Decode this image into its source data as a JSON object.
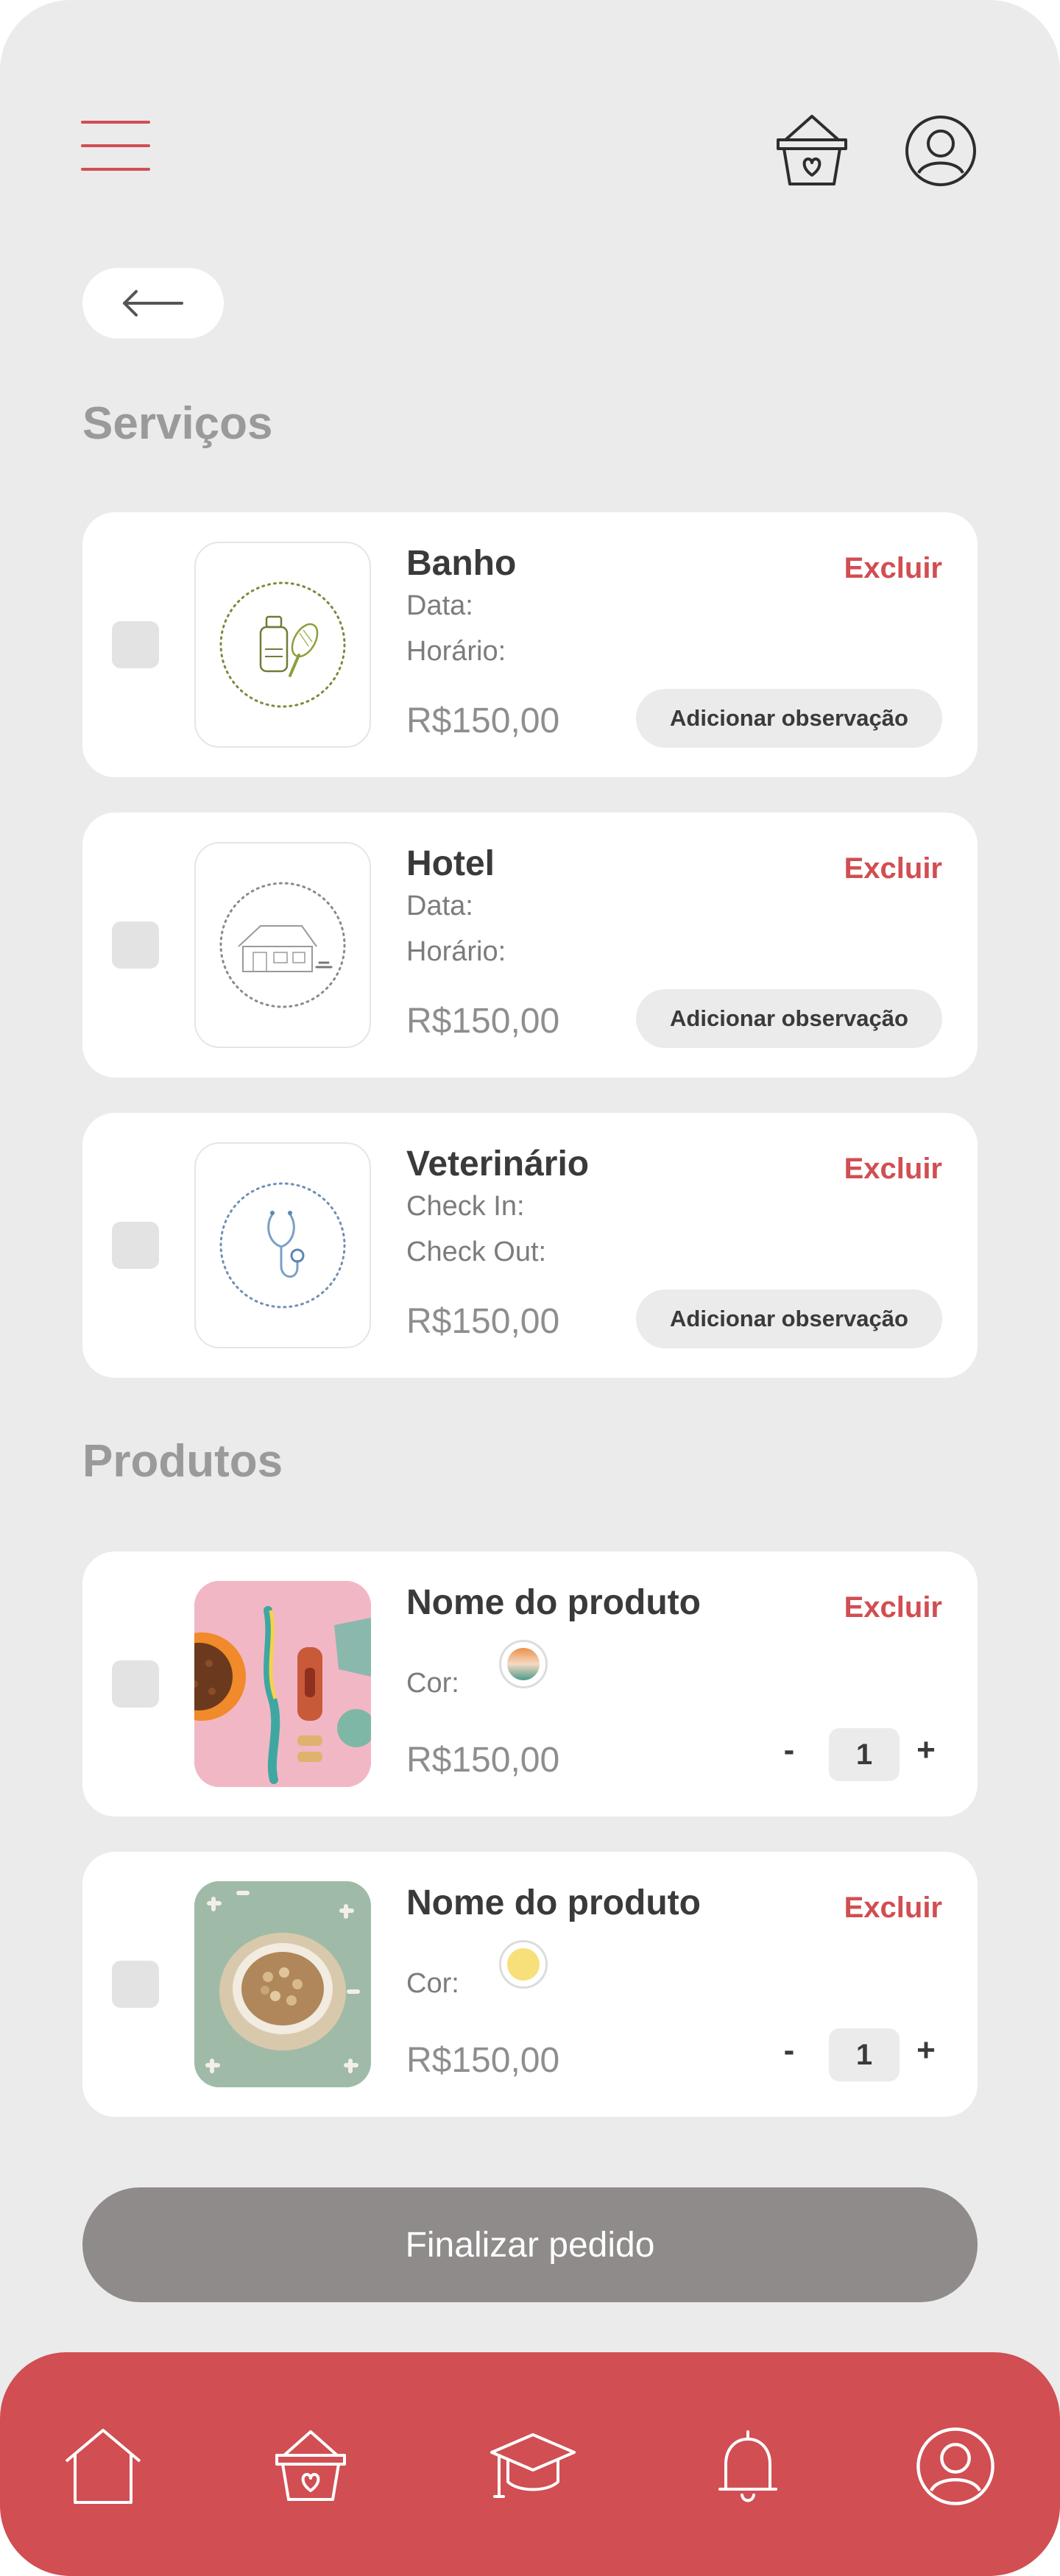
{
  "colors": {
    "accent": "#d14e52",
    "background": "#ebebeb",
    "card": "#ffffff",
    "finalize_button": "#8f8b8b"
  },
  "header": {
    "menu_icon": "hamburger-menu-icon",
    "cart_icon": "basket-heart-icon",
    "profile_icon": "user-circle-icon",
    "back_icon": "arrow-left-icon"
  },
  "sections": {
    "services_title": "Serviços",
    "products_title": "Produtos"
  },
  "services": [
    {
      "name": "Banho",
      "line1": "Data:",
      "line2": "Horário:",
      "price": "R$150,00",
      "delete_label": "Excluir",
      "note_label": "Adicionar observação",
      "icon": "bath-products-icon"
    },
    {
      "name": "Hotel",
      "line1": "Data:",
      "line2": "Horário:",
      "price": "R$150,00",
      "delete_label": "Excluir",
      "note_label": "Adicionar observação",
      "icon": "pet-house-icon"
    },
    {
      "name": "Veterinário",
      "line1": "Check In:",
      "line2": "Check Out:",
      "price": "R$150,00",
      "delete_label": "Excluir",
      "note_label": "Adicionar observação",
      "icon": "stethoscope-icon"
    }
  ],
  "products": [
    {
      "name": "Nome do produto",
      "color_label": "Cor:",
      "price": "R$150,00",
      "delete_label": "Excluir",
      "qty": "1",
      "minus": "-",
      "plus": "+",
      "swatch": "#e8924a",
      "image": "pet-toys-photo"
    },
    {
      "name": "Nome do produto",
      "color_label": "Cor:",
      "price": "R$150,00",
      "delete_label": "Excluir",
      "qty": "1",
      "minus": "-",
      "plus": "+",
      "swatch": "#f7e07a",
      "image": "pet-food-bowl-photo"
    }
  ],
  "finalize_label": "Finalizar pedido",
  "bottom_nav": [
    "home-icon",
    "basket-heart-icon",
    "graduation-cap-icon",
    "bell-icon",
    "user-circle-icon"
  ]
}
